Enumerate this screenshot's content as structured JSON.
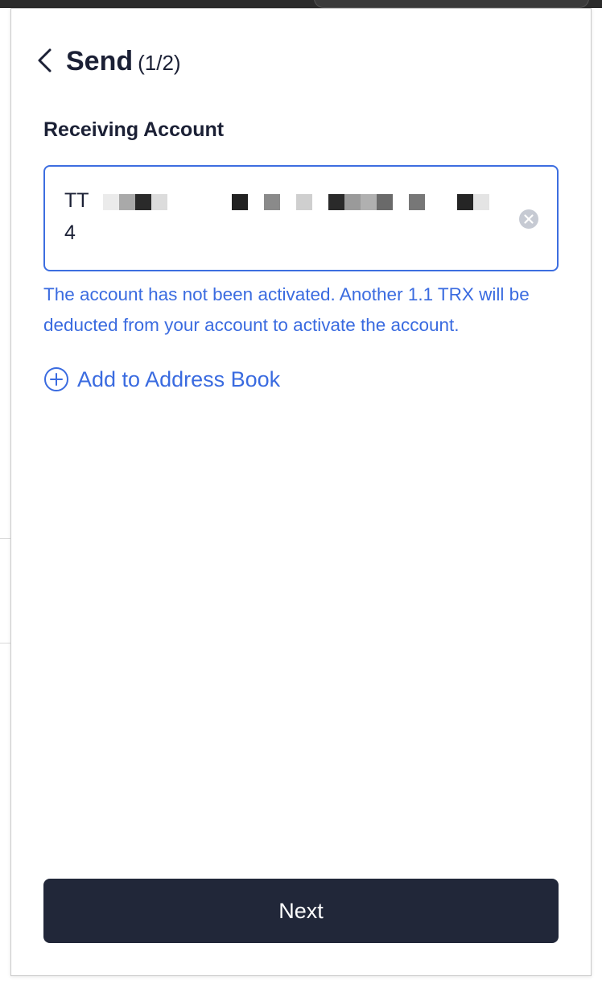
{
  "header": {
    "title": "Send",
    "step": "(1/2)"
  },
  "receiving": {
    "label": "Receiving Account",
    "address_line1_prefix": "TT",
    "address_line2": "4"
  },
  "warning": {
    "text": "The account has not been activated. Another 1.1 TRX will be deducted from your account to activate the account."
  },
  "address_book": {
    "label": "Add to Address Book"
  },
  "footer": {
    "next_label": "Next"
  },
  "colors": {
    "accent": "#3a6be0",
    "button_bg": "#212739",
    "text_primary": "#1b2035"
  },
  "icons": {
    "back": "chevron-left-icon",
    "clear": "clear-circle-icon",
    "add": "plus-circle-icon"
  }
}
